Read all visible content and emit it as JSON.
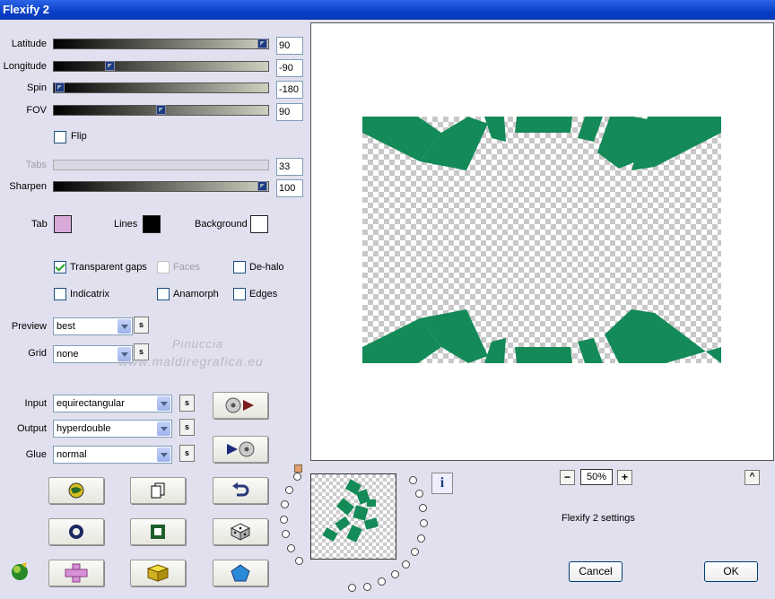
{
  "title": "Flexify 2",
  "sliders": [
    {
      "label": "Latitude",
      "value": "90",
      "pos": 1.0
    },
    {
      "label": "Longitude",
      "value": "-90",
      "pos": 0.25
    },
    {
      "label": "Spin",
      "value": "-180",
      "pos": 0.0
    },
    {
      "label": "FOV",
      "value": "90",
      "pos": 0.5
    }
  ],
  "flip": {
    "label": "Flip",
    "checked": false
  },
  "tabs_slider": {
    "label": "Tabs",
    "value": "33",
    "enabled": false
  },
  "sharpen": {
    "label": "Sharpen",
    "value": "100",
    "pos": 1.0
  },
  "colors": {
    "tab": {
      "label": "Tab",
      "color": "#d8a8d8"
    },
    "lines": {
      "label": "Lines",
      "color": "#000000"
    },
    "background": {
      "label": "Background",
      "color": "#ffffff"
    }
  },
  "checkboxes": {
    "transparent_gaps": {
      "label": "Transparent gaps",
      "checked": true
    },
    "faces": {
      "label": "Faces",
      "checked": false
    },
    "de_halo": {
      "label": "De-halo",
      "checked": false
    },
    "indicatrix": {
      "label": "Indicatrix",
      "checked": false
    },
    "anamorph": {
      "label": "Anamorph",
      "checked": false
    },
    "edges": {
      "label": "Edges",
      "checked": false
    }
  },
  "preview_select": {
    "label": "Preview",
    "value": "best"
  },
  "grid_select": {
    "label": "Grid",
    "value": "none"
  },
  "input_select": {
    "label": "Input",
    "value": "equirectangular"
  },
  "output_select": {
    "label": "Output",
    "value": "hyperdouble"
  },
  "glue_select": {
    "label": "Glue",
    "value": "normal"
  },
  "s_label": "s",
  "watermark": {
    "line1": "Pinuccia",
    "line2": "www.maldiregrafica.eu"
  },
  "zoom": {
    "minus": "−",
    "value": "50%",
    "plus": "+"
  },
  "info_label": "i",
  "caret": "^",
  "status": "Flexify 2 settings",
  "buttons": {
    "cancel": "Cancel",
    "ok": "OK"
  },
  "accent_green": "#138a57"
}
